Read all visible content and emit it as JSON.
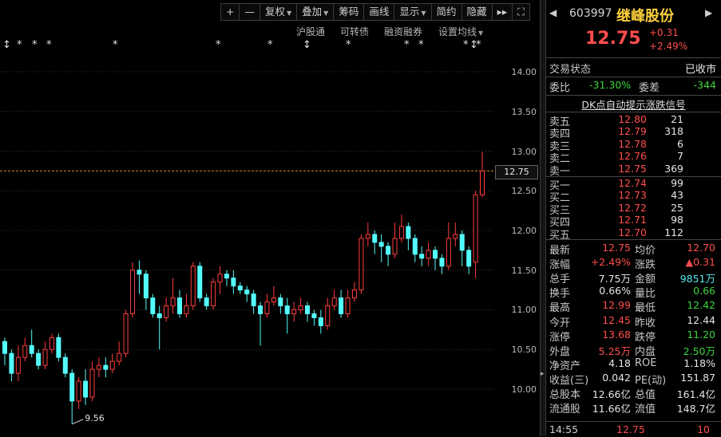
{
  "toolbar": {
    "plus": "+",
    "minus": "—",
    "items": [
      {
        "label": "复权",
        "dropdown": true
      },
      {
        "label": "叠加",
        "dropdown": true
      },
      {
        "label": "筹码",
        "dropdown": false
      },
      {
        "label": "画线",
        "dropdown": false
      },
      {
        "label": "显示",
        "dropdown": true
      },
      {
        "label": "简约",
        "dropdown": false
      },
      {
        "label": "隐藏",
        "dropdown": false
      }
    ],
    "more": "▸▸",
    "fullscreen": "⛶"
  },
  "subbar": {
    "items": [
      "沪股通",
      "可转债",
      "融资融券",
      "设置均线"
    ]
  },
  "markers": [
    "↕",
    "*",
    "*",
    "*",
    "*",
    "*",
    "*",
    "↕",
    "*",
    "*",
    "*",
    "*",
    "↕",
    "*",
    "*"
  ],
  "axis": {
    "labels": [
      "14.00",
      "13.50",
      "13.00",
      "12.50",
      "12.00",
      "11.50",
      "11.00",
      "10.50",
      "10.00"
    ],
    "current_price": "12.75",
    "low_annotation": "9.56"
  },
  "chart_data": {
    "type": "candlestick",
    "ylim": [
      9.5,
      14.2
    ],
    "current_price": 12.75,
    "low_point": 9.56,
    "candles": [
      [
        10.6,
        10.45,
        10.65,
        10.3
      ],
      [
        10.45,
        10.2,
        10.5,
        10.1
      ],
      [
        10.2,
        10.4,
        10.55,
        10.1
      ],
      [
        10.4,
        10.55,
        10.65,
        10.35
      ],
      [
        10.55,
        10.45,
        10.75,
        10.4
      ],
      [
        10.45,
        10.3,
        10.5,
        10.25
      ],
      [
        10.3,
        10.5,
        10.6,
        10.25
      ],
      [
        10.5,
        10.65,
        10.7,
        10.45
      ],
      [
        10.65,
        10.4,
        10.7,
        10.35
      ],
      [
        10.4,
        10.2,
        10.45,
        10.15
      ],
      [
        10.2,
        9.85,
        10.25,
        9.56
      ],
      [
        9.85,
        10.1,
        10.15,
        9.75
      ],
      [
        10.1,
        9.9,
        10.25,
        9.8
      ],
      [
        9.9,
        10.25,
        10.35,
        9.85
      ],
      [
        10.25,
        10.3,
        10.4,
        10.15
      ],
      [
        10.3,
        10.25,
        10.4,
        10.15
      ],
      [
        10.25,
        10.35,
        10.45,
        10.2
      ],
      [
        10.35,
        10.45,
        10.6,
        10.3
      ],
      [
        10.45,
        10.95,
        11.0,
        10.4
      ],
      [
        10.95,
        11.5,
        11.6,
        10.9
      ],
      [
        11.5,
        11.45,
        11.62,
        11.2
      ],
      [
        11.45,
        11.15,
        11.5,
        11.0
      ],
      [
        11.15,
        10.95,
        11.2,
        10.9
      ],
      [
        10.95,
        10.9,
        11.05,
        10.5
      ],
      [
        10.9,
        11.05,
        11.15,
        10.85
      ],
      [
        11.05,
        11.15,
        11.4,
        10.95
      ],
      [
        11.15,
        10.95,
        11.25,
        10.9
      ],
      [
        10.95,
        11.05,
        11.2,
        10.9
      ],
      [
        11.05,
        11.55,
        11.6,
        11.0
      ],
      [
        11.55,
        11.15,
        11.6,
        11.1
      ],
      [
        11.15,
        11.05,
        11.2,
        11.0
      ],
      [
        11.05,
        11.35,
        11.4,
        11.0
      ],
      [
        11.35,
        11.45,
        11.55,
        11.2
      ],
      [
        11.45,
        11.4,
        11.5,
        11.3
      ],
      [
        11.4,
        11.3,
        11.5,
        11.2
      ],
      [
        11.3,
        11.25,
        11.35,
        11.2
      ],
      [
        11.25,
        11.2,
        11.3,
        11.1
      ],
      [
        11.2,
        11.05,
        11.25,
        10.95
      ],
      [
        11.05,
        10.95,
        11.1,
        10.55
      ],
      [
        10.95,
        11.1,
        11.2,
        10.9
      ],
      [
        11.1,
        11.15,
        11.3,
        11.05
      ],
      [
        11.15,
        11.05,
        11.2,
        10.95
      ],
      [
        11.05,
        10.95,
        11.15,
        10.7
      ],
      [
        10.95,
        11.0,
        11.1,
        10.85
      ],
      [
        11.0,
        11.05,
        11.15,
        10.95
      ],
      [
        11.05,
        10.95,
        11.1,
        10.85
      ],
      [
        10.95,
        10.9,
        11.0,
        10.8
      ],
      [
        10.9,
        10.8,
        11.0,
        10.7
      ],
      [
        10.8,
        11.05,
        11.15,
        10.75
      ],
      [
        11.05,
        11.15,
        11.25,
        11.0
      ],
      [
        11.15,
        10.95,
        11.25,
        10.9
      ],
      [
        10.95,
        11.15,
        11.25,
        10.9
      ],
      [
        11.15,
        11.25,
        11.35,
        11.1
      ],
      [
        11.25,
        11.9,
        11.95,
        11.2
      ],
      [
        11.9,
        11.95,
        12.1,
        11.8
      ],
      [
        11.95,
        11.85,
        12.0,
        11.7
      ],
      [
        11.85,
        11.8,
        11.95,
        11.6
      ],
      [
        11.8,
        11.7,
        11.85,
        11.55
      ],
      [
        11.7,
        11.9,
        12.1,
        11.65
      ],
      [
        11.9,
        12.05,
        12.2,
        11.85
      ],
      [
        12.05,
        11.9,
        12.1,
        11.75
      ],
      [
        11.9,
        11.7,
        11.95,
        11.6
      ],
      [
        11.7,
        11.65,
        11.8,
        11.55
      ],
      [
        11.65,
        11.75,
        11.85,
        11.55
      ],
      [
        11.75,
        11.65,
        11.8,
        11.5
      ],
      [
        11.65,
        11.55,
        11.7,
        11.45
      ],
      [
        11.55,
        11.9,
        12.1,
        11.5
      ],
      [
        11.9,
        11.95,
        12.1,
        11.8
      ],
      [
        11.95,
        11.75,
        12.0,
        11.55
      ],
      [
        11.75,
        11.55,
        11.8,
        11.45
      ],
      [
        11.6,
        12.45,
        12.5,
        11.4
      ],
      [
        12.45,
        12.75,
        12.99,
        12.42
      ]
    ]
  },
  "quote": {
    "code": "603997",
    "name": "继峰股份",
    "price": "12.75",
    "change": "+0.31",
    "pct": "+2.49%"
  },
  "status": {
    "label": "交易状态",
    "value": "已收市",
    "weibi_label": "委比",
    "weibi": "-31.30%",
    "weicha_label": "委差",
    "weicha": "-344"
  },
  "signal_link": "DK点自动提示涨跌信号",
  "asks": [
    {
      "label": "卖五",
      "price": "12.80",
      "vol": "21"
    },
    {
      "label": "卖四",
      "price": "12.79",
      "vol": "318"
    },
    {
      "label": "卖三",
      "price": "12.78",
      "vol": "6"
    },
    {
      "label": "卖二",
      "price": "12.76",
      "vol": "7"
    },
    {
      "label": "卖一",
      "price": "12.75",
      "vol": "369"
    }
  ],
  "bids": [
    {
      "label": "买一",
      "price": "12.74",
      "vol": "99"
    },
    {
      "label": "买二",
      "price": "12.73",
      "vol": "43"
    },
    {
      "label": "买三",
      "price": "12.72",
      "vol": "25"
    },
    {
      "label": "买四",
      "price": "12.71",
      "vol": "98"
    },
    {
      "label": "买五",
      "price": "12.70",
      "vol": "112"
    }
  ],
  "stats": [
    {
      "l1": "最新",
      "v1": "12.75",
      "c1": "red",
      "l2": "均价",
      "v2": "12.70",
      "c2": "red"
    },
    {
      "l1": "涨幅",
      "v1": "+2.49%",
      "c1": "red",
      "l2": "涨跌",
      "v2": "▲0.31",
      "c2": "red"
    },
    {
      "l1": "总手",
      "v1": "7.75万",
      "c1": "wht",
      "l2": "金额",
      "v2": "9851万",
      "c2": "cyan"
    },
    {
      "l1": "换手",
      "v1": "0.66%",
      "c1": "wht",
      "l2": "量比",
      "v2": "0.66",
      "c2": "grn"
    },
    {
      "l1": "最高",
      "v1": "12.99",
      "c1": "red",
      "l2": "最低",
      "v2": "12.42",
      "c2": "grn"
    },
    {
      "l1": "今开",
      "v1": "12.45",
      "c1": "red",
      "l2": "昨收",
      "v2": "12.44",
      "c2": "wht"
    },
    {
      "l1": "涨停",
      "v1": "13.68",
      "c1": "red",
      "l2": "跌停",
      "v2": "11.20",
      "c2": "grn"
    },
    {
      "l1": "外盘",
      "v1": "5.25万",
      "c1": "red",
      "l2": "内盘",
      "v2": "2.50万",
      "c2": "grn"
    },
    {
      "l1": "净资产",
      "v1": "4.18",
      "c1": "wht",
      "l2": "ROE",
      "v2": "1.18%",
      "c2": "wht"
    },
    {
      "l1": "收益(三)",
      "v1": "0.042",
      "c1": "wht",
      "l2": "PE(动)",
      "v2": "151.87",
      "c2": "wht"
    },
    {
      "l1": "总股本",
      "v1": "12.66亿",
      "c1": "wht",
      "l2": "总值",
      "v2": "161.4亿",
      "c2": "wht"
    },
    {
      "l1": "流通股",
      "v1": "11.66亿",
      "c1": "wht",
      "l2": "流值",
      "v2": "148.7亿",
      "c2": "wht"
    }
  ],
  "footer": {
    "time": "14:55",
    "price": "12.75",
    "vol": "10"
  }
}
